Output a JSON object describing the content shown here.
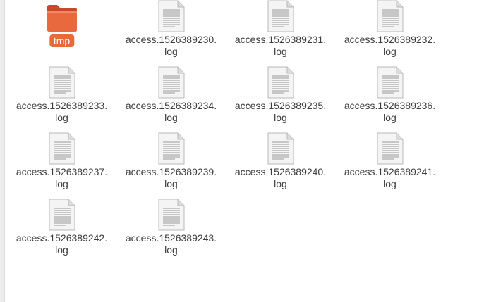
{
  "folder": {
    "name": "tmp",
    "icon": "folder-icon",
    "color": "#e9693f"
  },
  "files": [
    {
      "line1": "access.1526389230.",
      "line2": "log",
      "icon": "text-file-icon"
    },
    {
      "line1": "access.1526389231.",
      "line2": "log",
      "icon": "text-file-icon"
    },
    {
      "line1": "access.1526389232.",
      "line2": "log",
      "icon": "text-file-icon"
    },
    {
      "line1": "access.1526389233.",
      "line2": "log",
      "icon": "text-file-icon"
    },
    {
      "line1": "access.1526389234.",
      "line2": "log",
      "icon": "text-file-icon"
    },
    {
      "line1": "access.1526389235.",
      "line2": "log",
      "icon": "text-file-icon"
    },
    {
      "line1": "access.1526389236.",
      "line2": "log",
      "icon": "text-file-icon"
    },
    {
      "line1": "access.1526389237.",
      "line2": "log",
      "icon": "text-file-icon"
    },
    {
      "line1": "access.1526389239.",
      "line2": "log",
      "icon": "text-file-icon"
    },
    {
      "line1": "access.1526389240.",
      "line2": "log",
      "icon": "text-file-icon"
    },
    {
      "line1": "access.1526389241.",
      "line2": "log",
      "icon": "text-file-icon"
    },
    {
      "line1": "access.1526389242.",
      "line2": "log",
      "icon": "text-file-icon"
    },
    {
      "line1": "access.1526389243.",
      "line2": "log",
      "icon": "text-file-icon"
    }
  ]
}
